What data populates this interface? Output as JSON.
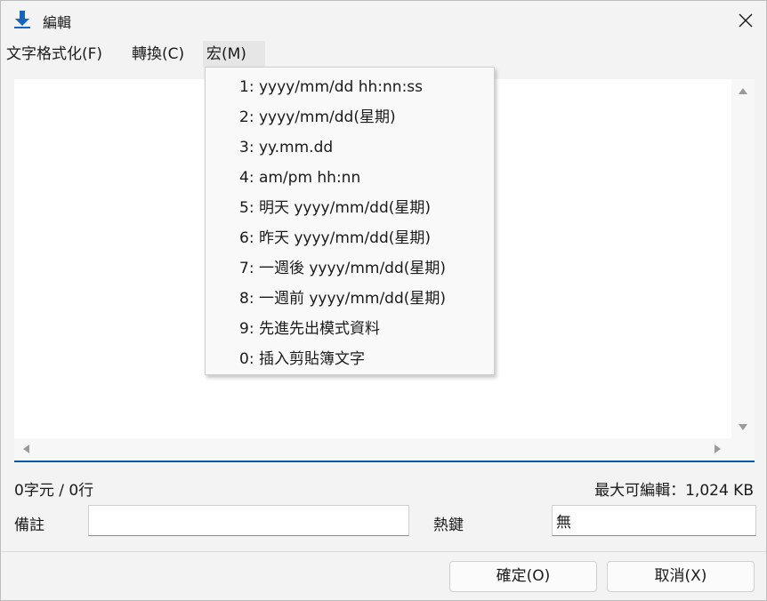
{
  "window": {
    "title": "編輯",
    "close_glyph": "✕"
  },
  "menu": {
    "items": [
      {
        "label": "文字格式化(F)"
      },
      {
        "label": "轉換(C)"
      },
      {
        "label": "宏(M)"
      }
    ],
    "active_index": 2
  },
  "macro_menu": {
    "items": [
      {
        "label": "1: yyyy/mm/dd hh:nn:ss"
      },
      {
        "label": "2: yyyy/mm/dd(星期)"
      },
      {
        "label": "3: yy.mm.dd"
      },
      {
        "label": "4: am/pm hh:nn"
      },
      {
        "label": "5: 明天 yyyy/mm/dd(星期)"
      },
      {
        "label": "6: 昨天 yyyy/mm/dd(星期)"
      },
      {
        "label": "7: 一週後 yyyy/mm/dd(星期)"
      },
      {
        "label": "8: 一週前 yyyy/mm/dd(星期)"
      },
      {
        "label": "9: 先進先出模式資料"
      },
      {
        "label": "0: 插入剪貼簿文字"
      }
    ]
  },
  "editor": {
    "content": ""
  },
  "status": {
    "count": "0字元 / 0行",
    "max_edit": "最大可編輯：1,024 KB"
  },
  "fields": {
    "note_label": "備註",
    "note_value": "",
    "hotkey_label": "熱鍵",
    "hotkey_value": "無"
  },
  "buttons": {
    "ok": "確定(O)",
    "cancel": "取消(X)"
  },
  "colors": {
    "accent": "#0a5aa8",
    "icon_blue": "#1565c0"
  }
}
